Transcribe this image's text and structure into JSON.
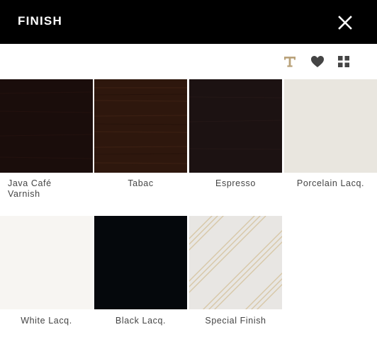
{
  "header": {
    "title": "FINISH",
    "close_icon": "close-icon"
  },
  "toolbar": {
    "icons": [
      "text-icon",
      "heart-icon",
      "grid-icon"
    ],
    "accent_color": "#b9a27a"
  },
  "finishes": [
    {
      "name": "Java Café Varnish",
      "line1": "Java Café",
      "line2": "Varnish",
      "color": "#1a0d0b"
    },
    {
      "name": "Tabac",
      "color": "#2e170d"
    },
    {
      "name": "Espresso",
      "color": "#1c1212"
    },
    {
      "name": "Porcelain Lacq.",
      "color": "#e9e6df"
    },
    {
      "name": "White Lacq.",
      "color": "#f7f5f2"
    },
    {
      "name": "Black Lacq.",
      "color": "#05080c"
    },
    {
      "name": "Special Finish",
      "color": "#e8e6e3",
      "stripe_color": "#d7c7a7"
    }
  ]
}
